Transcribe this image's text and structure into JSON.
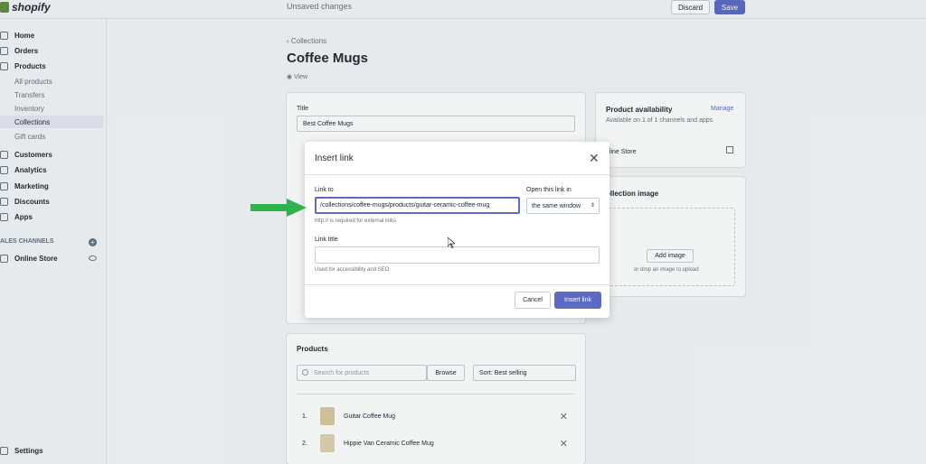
{
  "app": {
    "brand": "shopify",
    "status": "Unsaved changes",
    "discard": "Discard",
    "save": "Save"
  },
  "sidebar": {
    "items": [
      {
        "label": "Home"
      },
      {
        "label": "Orders"
      },
      {
        "label": "Products"
      },
      {
        "label": "All products"
      },
      {
        "label": "Transfers"
      },
      {
        "label": "Inventory"
      },
      {
        "label": "Collections"
      },
      {
        "label": "Gift cards"
      },
      {
        "label": "Customers"
      },
      {
        "label": "Analytics"
      },
      {
        "label": "Marketing"
      },
      {
        "label": "Discounts"
      },
      {
        "label": "Apps"
      }
    ],
    "sales_channels": "ALES CHANNELS",
    "online_store": "Online Store",
    "settings": "Settings"
  },
  "page": {
    "breadcrumb": "Collections",
    "title": "Coffee Mugs",
    "view": "View",
    "title_label": "Title",
    "title_value": "Best Coffee Mugs",
    "availability_title": "Product availability",
    "manage": "Manage",
    "availability_sub": "Available on 1 of 1 channels and apps",
    "online_store": "nline Store",
    "collection_image": "ollection image",
    "add_image": "Add image",
    "drop_hint": "or drop an image to upload",
    "products_title": "Products",
    "search_placeholder": "Search for products",
    "browse": "Browse",
    "sort": "Sort: Best selling",
    "products": [
      {
        "num": "1.",
        "name": "Guitar Coffee Mug"
      },
      {
        "num": "2.",
        "name": "Hippie Van Ceramic Coffee Mug"
      }
    ]
  },
  "modal": {
    "title": "Insert link",
    "link_to_label": "Link to",
    "link_to_value": "/collections/coffee-mugs/products/guitar-ceramic-coffee-mug",
    "link_hint": "http:// is required for external links",
    "open_label": "Open this link in",
    "open_value": "the same window",
    "link_title_label": "Link title",
    "link_title_value": "",
    "title_hint": "Used for accessibility and SEO",
    "cancel": "Cancel",
    "insert": "Insert link"
  },
  "colors": {
    "accent": "#5c6ac4",
    "arrow": "#2db34a",
    "brand": "#5e8e3e"
  }
}
